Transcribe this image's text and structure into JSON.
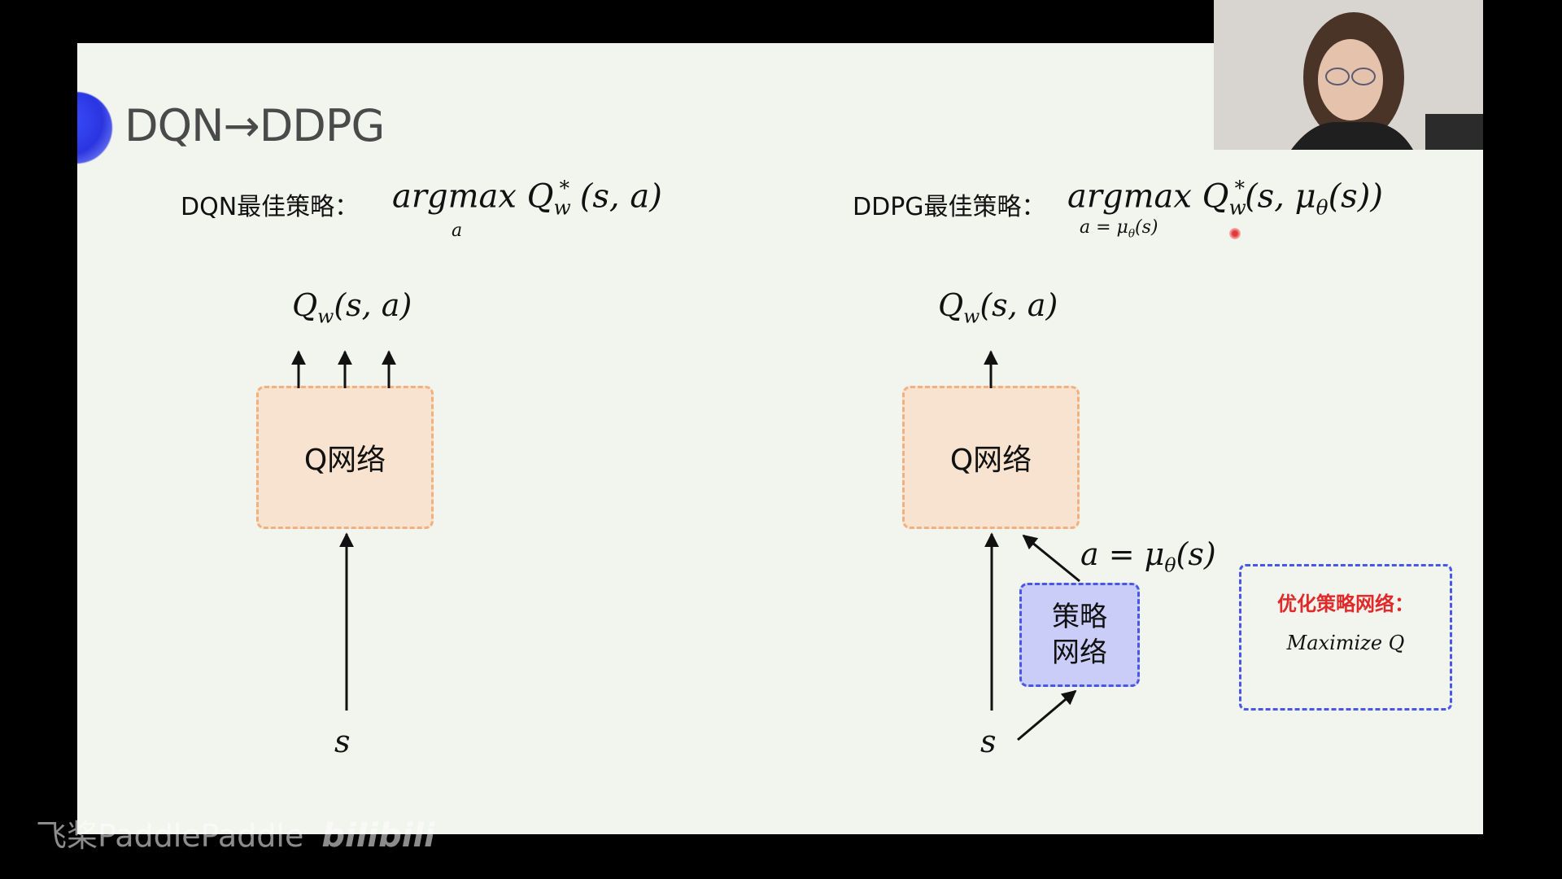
{
  "slide": {
    "title": "DQN→DDPG",
    "left": {
      "policy_label": "DQN最佳策略：",
      "formula_main": "argmax",
      "formula_q": "Q",
      "formula_sub_w": "w",
      "formula_sup_star": "*",
      "formula_args": "(s, a)",
      "formula_under": "a",
      "output_q": "Q",
      "output_sub_w": "w",
      "output_args": "(s, a)",
      "qnet_label": "Q网络",
      "input_s": "s"
    },
    "right": {
      "policy_label": "DDPG最佳策略：",
      "formula_main": "argmax",
      "formula_q": "Q",
      "formula_sub_w": "w",
      "formula_sup_star": "*",
      "formula_args_pre": "(s, μ",
      "formula_args_sub": "θ",
      "formula_args_post": "(s))",
      "formula_under_pre": "a = μ",
      "formula_under_sub": "θ",
      "formula_under_post": "(s)",
      "output_q": "Q",
      "output_sub_w": "w",
      "output_args": "(s, a)",
      "qnet_label": "Q网络",
      "action_pre": "a = μ",
      "action_sub": "θ",
      "action_post": "(s)",
      "policy_net_line1": "策略",
      "policy_net_line2": "网络",
      "input_s": "s",
      "optimize_title": "优化策略网络：",
      "optimize_body": "Maximize Q"
    }
  },
  "watermark": {
    "brand1": "飞桨PaddlePaddle",
    "brand2": "bilibili"
  },
  "colors": {
    "qnet_fill": "#f7e3cf",
    "qnet_border": "#f2b07e",
    "policy_fill": "#c9cdf7",
    "policy_border": "#4957e8",
    "optimize_title": "#e02a2a",
    "title_text": "#4a4a4a"
  }
}
